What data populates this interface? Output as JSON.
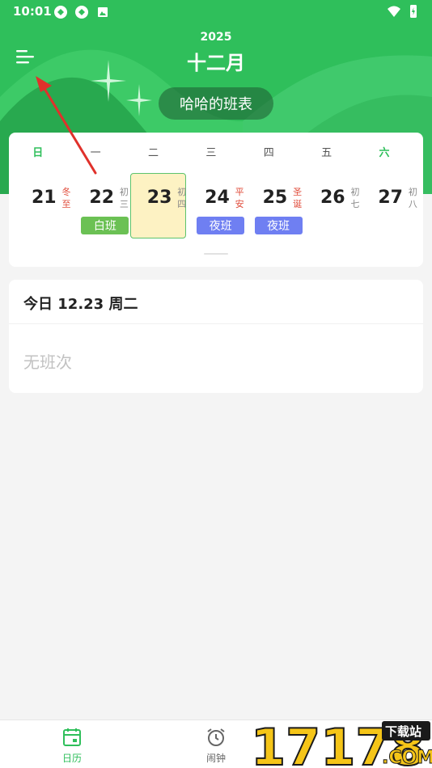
{
  "status_bar": {
    "time": "10:01"
  },
  "header": {
    "year": "2025",
    "month": "十二月",
    "schedule_name": "哈哈的班表"
  },
  "weekdays": [
    "日",
    "一",
    "二",
    "三",
    "四",
    "五",
    "六"
  ],
  "days": [
    {
      "num": "21",
      "lunar": "冬至",
      "festival": true
    },
    {
      "num": "22",
      "lunar": "初三",
      "festival": false,
      "shift": "白班"
    },
    {
      "num": "23",
      "lunar": "初四",
      "festival": false
    },
    {
      "num": "24",
      "lunar": "平安",
      "festival": true,
      "shift": "夜班"
    },
    {
      "num": "25",
      "lunar": "圣诞",
      "festival": true,
      "shift": "夜班"
    },
    {
      "num": "26",
      "lunar": "初七",
      "festival": false
    },
    {
      "num": "27",
      "lunar": "初八",
      "festival": false
    }
  ],
  "today": {
    "title": "今日 12.23 周二",
    "empty_text": "无班次"
  },
  "nav": {
    "calendar_label": "日历",
    "alarm_label": "闹钟"
  },
  "watermark": {
    "number": "17178",
    "badge": "下载站",
    "domain": ".COM"
  },
  "colors": {
    "primary": "#2fbf5b",
    "day_shift": "#6bc154",
    "night_shift": "#6f7ff2",
    "festival": "#e04b3a",
    "selected_bg": "#fdf2c3"
  }
}
